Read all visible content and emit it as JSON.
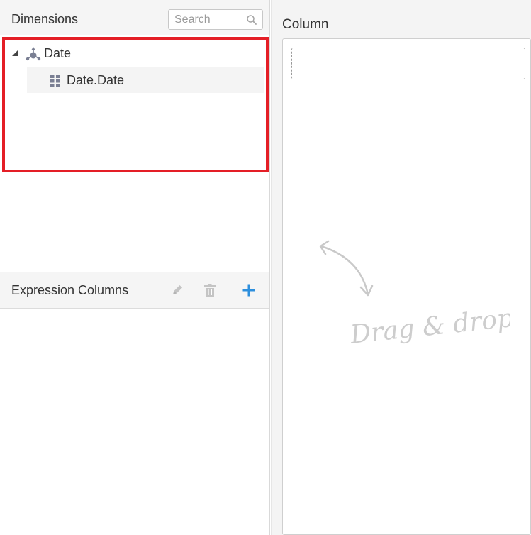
{
  "dimensions": {
    "title": "Dimensions",
    "search_placeholder": "Search",
    "tree": {
      "root_label": "Date",
      "root_icon": "dimension-icon",
      "child_label": "Date.Date",
      "child_icon": "grid-icon"
    }
  },
  "expression_columns": {
    "title": "Expression Columns",
    "toolbar": {
      "edit_icon": "pencil-icon",
      "delete_icon": "trash-icon",
      "add_icon": "plus-icon"
    }
  },
  "column_section": {
    "title": "Column",
    "drop_hint": "Drag & drop"
  },
  "colors": {
    "highlight": "#e41e26",
    "accent": "#2d8fdd",
    "icon_gray": "#7a7f93"
  }
}
